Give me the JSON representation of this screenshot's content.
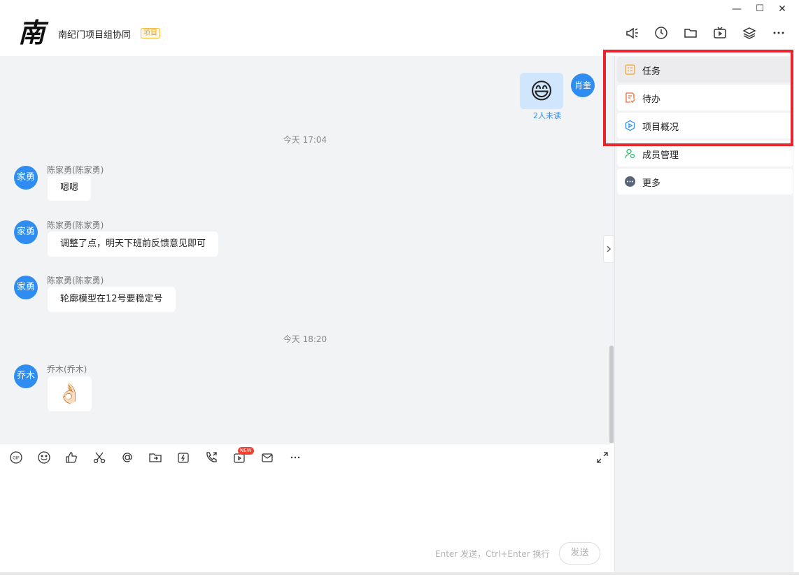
{
  "header": {
    "logo_char": "南",
    "title": "南纪门项目组协同",
    "tag": "项目",
    "window_controls": {
      "minimize": "—",
      "maximize": "☐",
      "close": "✕"
    },
    "icons": [
      "announcement-icon",
      "history-icon",
      "folder-icon",
      "tv-icon",
      "layers-icon",
      "more-icon"
    ]
  },
  "chat": {
    "self_message": {
      "avatar": "肖奎",
      "emoji": "😄",
      "read_status": "2人未读"
    },
    "timestamps": [
      "今天 17:04",
      "今天 18:20"
    ],
    "messages": [
      {
        "avatar": "家勇",
        "sender": "陈家勇(陈家勇)",
        "text": "嗯嗯"
      },
      {
        "avatar": "家勇",
        "sender": "陈家勇(陈家勇)",
        "text": "调整了点，明天下班前反馈意见即可"
      },
      {
        "avatar": "家勇",
        "sender": "陈家勇(陈家勇)",
        "text": "轮廓模型在12号要稳定号"
      },
      {
        "avatar": "乔木",
        "sender": "乔木(乔木)",
        "emoji": "👌🏻"
      }
    ]
  },
  "composer": {
    "tools": [
      "gif-icon",
      "emoji-icon",
      "thumbs-up-icon",
      "scissors-icon",
      "at-icon",
      "folder-send-icon",
      "flash-icon",
      "call-icon",
      "video-icon",
      "mail-icon",
      "more-icon"
    ],
    "new_badge": "NEW",
    "hint": "Enter 发送，Ctrl+Enter 换行",
    "send_label": "发送"
  },
  "panel": {
    "items": [
      {
        "label": "任务",
        "icon": "task-icon",
        "color": "#f5a623"
      },
      {
        "label": "待办",
        "icon": "todo-icon",
        "color": "#f06a3a"
      },
      {
        "label": "项目概况",
        "icon": "project-overview-icon",
        "color": "#2f8cf0"
      },
      {
        "label": "成员管理",
        "icon": "member-icon",
        "color": "#2dbd6e"
      },
      {
        "label": "更多",
        "icon": "more-circle-icon",
        "color": "#5a6478"
      }
    ]
  },
  "colors": {
    "accent": "#2f8cf0",
    "highlight": "#e8252f",
    "chat_bg": "#f2f3f5"
  }
}
